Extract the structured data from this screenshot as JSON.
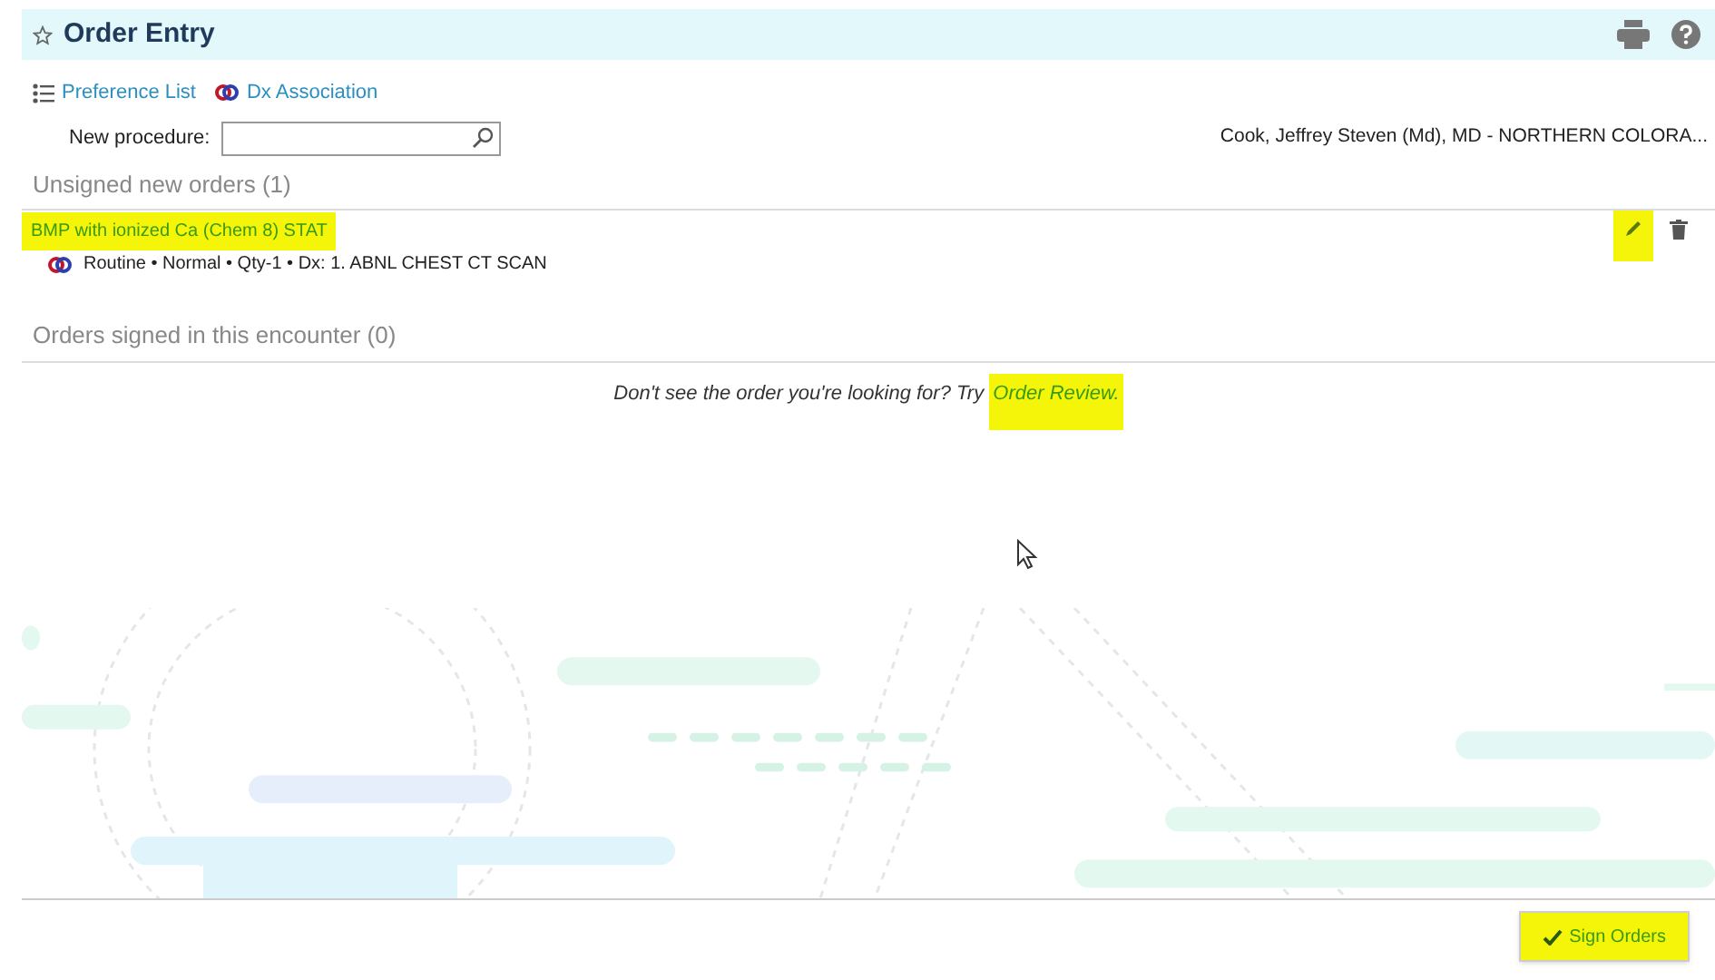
{
  "header": {
    "title": "Order Entry"
  },
  "toolbar": [
    {
      "label": "Preference List",
      "kind": "list"
    },
    {
      "label": "Dx Association",
      "kind": "link"
    }
  ],
  "new_procedure": {
    "label": "New procedure:"
  },
  "provider": "Cook, Jeffrey Steven (Md), MD - NORTHERN COLORA...",
  "unsigned": {
    "title": "Unsigned new orders (1)",
    "orders": [
      {
        "name": "BMP with ionized Ca (Chem 8) STAT",
        "highlighted": true,
        "details": "Routine • Normal • Qty-1 • Dx: 1. ABNL CHEST CT SCAN",
        "edit_highlighted": true
      }
    ]
  },
  "signed": {
    "title": "Orders signed in this encounter (0)"
  },
  "message": {
    "text": "Don't see the order you're looking for? Try",
    "link": "Order Review.",
    "link_highlighted": true
  },
  "sign_button": {
    "label": "Sign Orders",
    "highlighted": true
  }
}
